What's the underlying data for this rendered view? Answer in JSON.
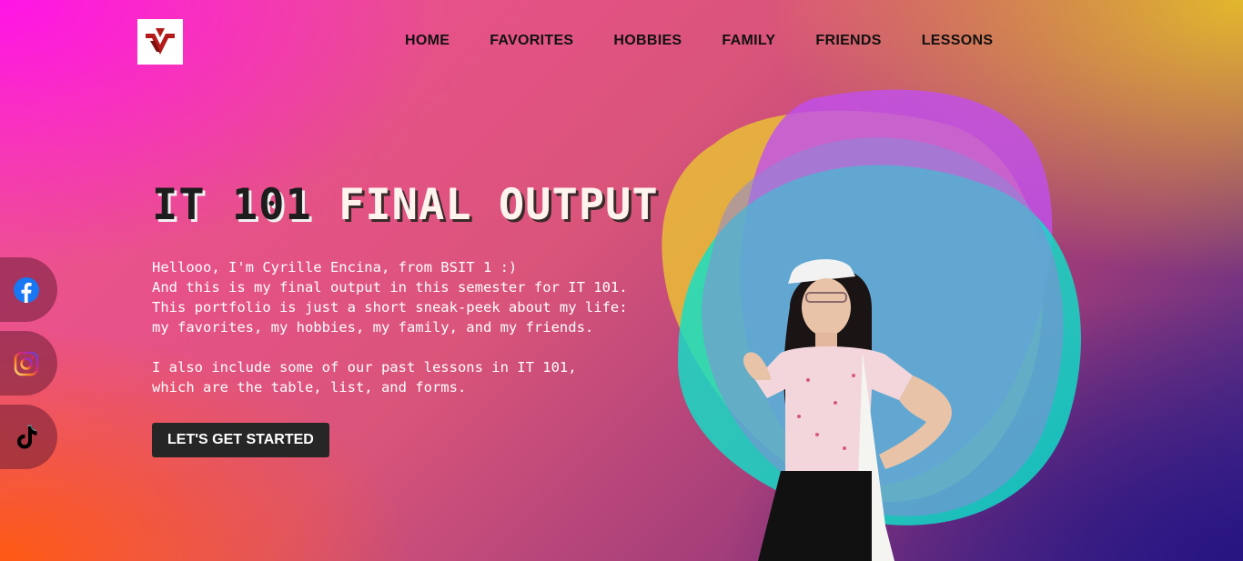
{
  "nav": {
    "items": [
      {
        "label": "HOME"
      },
      {
        "label": "FAVORITES"
      },
      {
        "label": "HOBBIES"
      },
      {
        "label": "FAMILY"
      },
      {
        "label": "FRIENDS"
      },
      {
        "label": "LESSONS"
      }
    ]
  },
  "hero": {
    "title_part1": "IT 101",
    "title_part2": "FINAL OUTPUT",
    "lines": [
      "Hellooo, I'm Cyrille Encina, from BSIT 1 :)",
      "And this is my final output in this semester for IT 101.",
      "This portfolio is just a short sneak-peek about my life:",
      "my favorites, my hobbies, my family, and my friends.",
      "I also include some of our past lessons in IT 101,",
      "which are the table, list, and forms."
    ],
    "cta_label": "LET'S GET STARTED"
  },
  "social": [
    {
      "icon": "facebook-icon",
      "color": "#1877f2"
    },
    {
      "icon": "instagram-icon",
      "color": "#e1306c"
    },
    {
      "icon": "tiktok-icon",
      "color": "#000000"
    }
  ],
  "colors": {
    "logo_red": "#b31b1b",
    "button_bg": "#262626"
  }
}
